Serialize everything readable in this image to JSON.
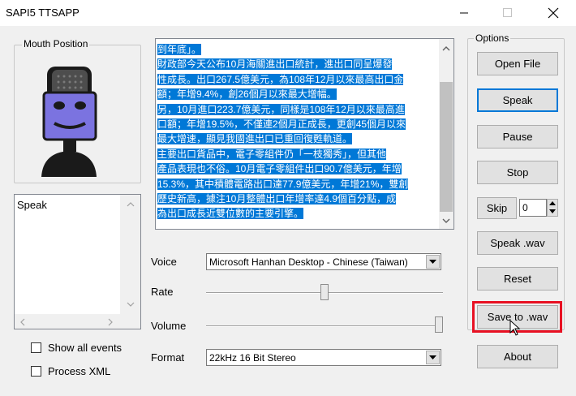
{
  "window": {
    "title": "SAPI5 TTSAPP"
  },
  "mouth_group": {
    "label": "Mouth Position"
  },
  "events_box": {
    "text": "Speak"
  },
  "checkboxes": {
    "show_all_events": "Show all events",
    "process_xml": "Process XML"
  },
  "text_area": {
    "lines": [
      {
        "text": "到年底」。",
        "selected": true
      },
      {
        "text": "財政部今天公布10月海關進出口統計，進出口同呈爆發",
        "selected": true
      },
      {
        "text": "性成長。出口267.5億美元，為108年12月以來最高出口金",
        "selected": true
      },
      {
        "text": "額；年增9.4%，創26個月以來最大增幅。",
        "selected": true
      },
      {
        "text": "另，10月進口223.7億美元，同樣是108年12月以來最高進",
        "selected": true
      },
      {
        "text": "口額；年增19.5%，不僅連2個月正成長，更創45個月以來",
        "selected": true
      },
      {
        "text": "最大增速，顯見我國進出口已重回復甦軌道。",
        "selected": true
      },
      {
        "text": "主要出口貨品中，電子零組件仍「一枝獨秀」，但其他",
        "selected": true
      },
      {
        "text": "產品表現也不俗。10月電子零組件出口90.7億美元，年增",
        "selected": true
      },
      {
        "text": "15.3%，其中積體電路出口達77.9億美元，年增21%，雙創",
        "selected": true
      },
      {
        "text": "歷史新高，據注10月整體出口年增率達4.9個百分點，成",
        "selected": true
      },
      {
        "text": "為出口成長近雙位數的主要引擎。",
        "selected": true
      }
    ]
  },
  "controls": {
    "voice_label": "Voice",
    "voice_value": "Microsoft Hanhan Desktop - Chinese (Taiwan)",
    "rate_label": "Rate",
    "rate_level": 0.5,
    "volume_label": "Volume",
    "volume_level": 1.0,
    "format_label": "Format",
    "format_value": "22kHz 16 Bit Stereo"
  },
  "options": {
    "label": "Options",
    "open_file": "Open File",
    "speak": "Speak",
    "pause": "Pause",
    "stop": "Stop",
    "skip": "Skip",
    "skip_value": "0",
    "speak_wav": "Speak .wav",
    "reset": "Reset",
    "save_to_wav": "Save to .wav",
    "about": "About"
  },
  "colors": {
    "selection": "#0078d7",
    "highlight_box": "#e81123",
    "avatar_face": "#7b73e0",
    "avatar_dark": "#1a1a1a"
  }
}
